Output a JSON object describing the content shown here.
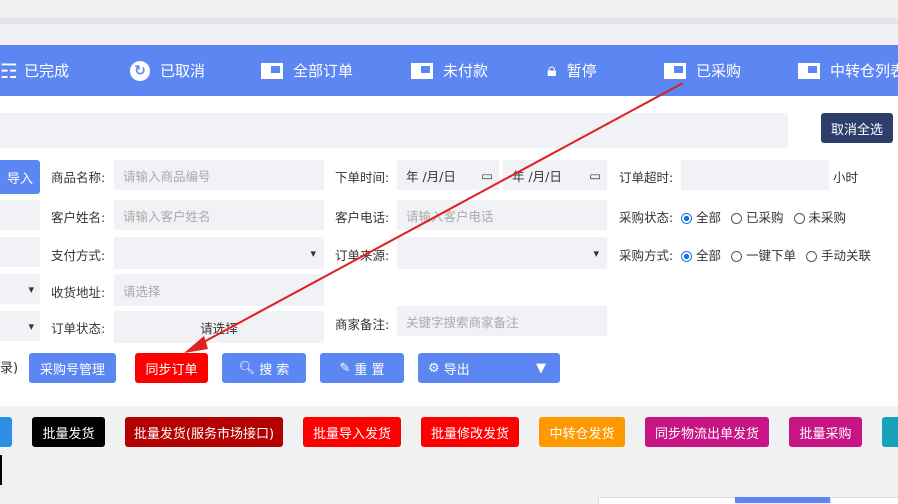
{
  "tabs": [
    {
      "label": "已完成",
      "icon": "list-check-icon"
    },
    {
      "label": "已取消",
      "icon": "redo-circle-icon"
    },
    {
      "label": "全部订单",
      "icon": "card-icon"
    },
    {
      "label": "未付款",
      "icon": "card-icon"
    },
    {
      "label": "暂停",
      "icon": "lock-icon"
    },
    {
      "label": "已采购",
      "icon": "card-icon"
    },
    {
      "label": "中转仓列表",
      "icon": "card-icon"
    }
  ],
  "toolbar": {
    "cancel_all": "取消全选",
    "import": "导入"
  },
  "filters": {
    "product_name": {
      "label": "商品名称:",
      "placeholder": "请输入商品编号"
    },
    "order_time": {
      "label": "下单时间:",
      "start": "年 /月/日",
      "end": "年 /月/日"
    },
    "order_timeout": {
      "label": "订单超时:",
      "unit": "小时"
    },
    "customer_name": {
      "label": "客户姓名:",
      "placeholder": "请输入客户姓名"
    },
    "customer_phone": {
      "label": "客户电话:",
      "placeholder": "请输入客户电话"
    },
    "purchase_status": {
      "label": "采购状态:",
      "options": [
        "全部",
        "已采购",
        "未采购"
      ],
      "selected": "全部"
    },
    "pay_method": {
      "label": "支付方式:"
    },
    "order_source": {
      "label": "订单来源:"
    },
    "purchase_method": {
      "label": "采购方式:",
      "options": [
        "全部",
        "一键下单",
        "手动关联"
      ],
      "selected": "全部"
    },
    "ship_address": {
      "label": "收货地址:",
      "placeholder": "请选择"
    },
    "order_status": {
      "label": "订单状态:",
      "value": "请选择"
    },
    "merchant_note": {
      "label": "商家备注:",
      "placeholder": "关键字搜索商家备注"
    },
    "left_partial": "录)"
  },
  "actions": {
    "purchase_no": "采购号管理",
    "sync": "同步订单",
    "search": "搜 索",
    "reset": "重 置",
    "export": "导出"
  },
  "batch": {
    "ship": "批量发货",
    "ship_market": "批量发货(服务市场接口)",
    "import_ship": "批量导入发货",
    "edit_ship": "批量修改发货",
    "transit_ship": "中转仓发货",
    "sync_logistics": "同步物流出单发货",
    "batch_purchase": "批量采购"
  },
  "colors": {
    "tabbar": "#5c87f2",
    "btn_blue": "#5c87f2",
    "btn_red": "#ff0000",
    "btn_dark_red": "#b30000",
    "btn_black": "#000000",
    "btn_orange": "#ff9900",
    "btn_magenta": "#c71585",
    "btn_navy": "#2d3e6b",
    "btn_teal": "#17a2b8",
    "arrow": "#e02020"
  }
}
